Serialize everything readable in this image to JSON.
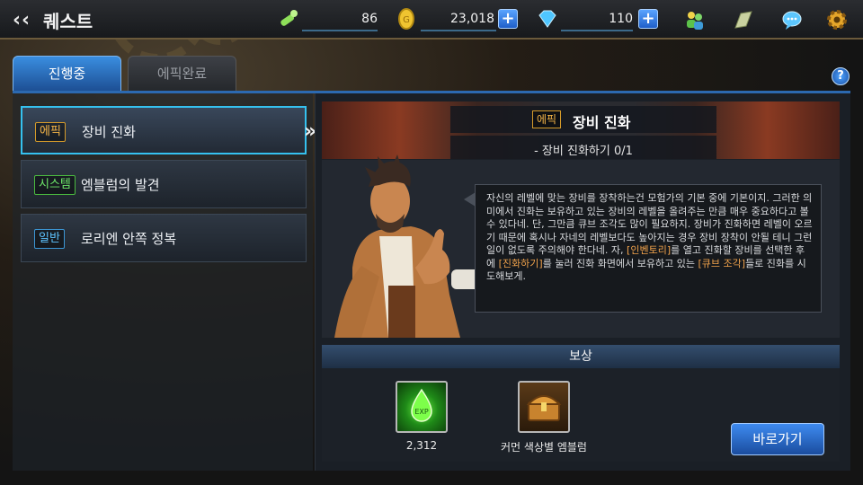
{
  "header": {
    "title": "퀘스트",
    "resources": {
      "stamina": "86",
      "gold": "23,018",
      "gems": "110"
    },
    "plus_label": "+"
  },
  "tabs": [
    {
      "label": "진행중",
      "active": true
    },
    {
      "label": "에픽완료",
      "active": false
    }
  ],
  "help_label": "?",
  "quests": [
    {
      "tag": "에픽",
      "name": "장비 진화",
      "selected": true
    },
    {
      "tag": "시스템",
      "name": "엠블럼의 발견",
      "selected": false
    },
    {
      "tag": "일반",
      "name": "로리엔 안쪽 정복",
      "selected": false
    }
  ],
  "detail": {
    "tag": "에픽",
    "title": "장비 진화",
    "objective": "- 장비 진화하기 0/1",
    "dialogue": {
      "line1": "자신의 레벨에 맞는 장비를 장착하는건 모험가의 기본 중에 기본이지. 그러한 의미에서 진화는 보유하고 있는 장비의 레벨을 올려주는 만큼 매우 중요하다고 볼 수 있다네. 단, 그만큼 큐브 조각도 많이 필요하지. 장비가 진화하면 레벨이 오르기 때문에 혹시나 자네의 레벨보다도 높아지는 경우 장비 장착이 안될 테니 그런일이 없도록 주의해야 한다네. 자,",
      "hl1": "[인벤토리]",
      "mid1": "를 열고 진화할 장비를 선택한 후에",
      "hl2": "[진화하기]",
      "mid2": "를 눌러 진화 화면에서 보유하고 있는",
      "hl3": "[큐브 조각]",
      "end": "들로 진화를 시도해보게."
    }
  },
  "reward": {
    "heading": "보상",
    "items": [
      {
        "icon": "green-essence-icon",
        "label": "2,312"
      },
      {
        "icon": "treasure-chest-icon",
        "label": "커먼 색상별 엠블럼"
      }
    ],
    "goto_label": "바로가기"
  },
  "colors": {
    "accent": "#35c1ef",
    "epic": "#f3b447",
    "system": "#6ee86a",
    "general": "#5ec3ff",
    "highlight": "#f2a34c"
  }
}
